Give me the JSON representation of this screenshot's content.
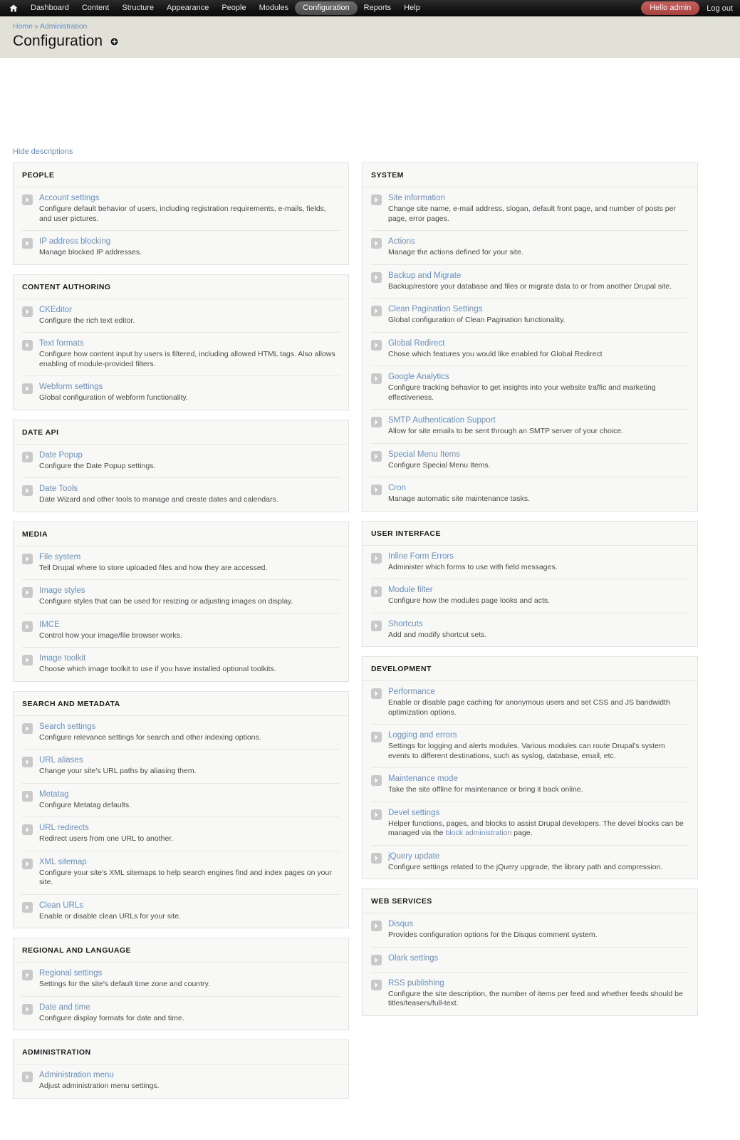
{
  "toolbar": {
    "home_icon": "home-icon",
    "items": [
      {
        "label": "Dashboard",
        "active": false
      },
      {
        "label": "Content",
        "active": false
      },
      {
        "label": "Structure",
        "active": false
      },
      {
        "label": "Appearance",
        "active": false
      },
      {
        "label": "People",
        "active": false
      },
      {
        "label": "Modules",
        "active": false
      },
      {
        "label": "Configuration",
        "active": true
      },
      {
        "label": "Reports",
        "active": false
      },
      {
        "label": "Help",
        "active": false
      }
    ],
    "greeting": "Hello admin",
    "logout": "Log out"
  },
  "breadcrumb": {
    "home": "Home",
    "separator": "»",
    "current": "Administration"
  },
  "page": {
    "title": "Configuration",
    "shortcut_icon": "add-shortcut-icon"
  },
  "actions": {
    "hide_descriptions": "Hide descriptions"
  },
  "colors": {
    "link": "#6a8fbd",
    "toolbar_bg": "#141414",
    "greeting_badge": "#b5524f",
    "panel_bg": "#f8f8f7",
    "header_bg": "#e2e1d7"
  },
  "left_column": [
    {
      "title": "PEOPLE",
      "items": [
        {
          "label": "Account settings",
          "desc": "Configure default behavior of users, including registration requirements, e-mails, fields, and user pictures."
        },
        {
          "label": "IP address blocking",
          "desc": "Manage blocked IP addresses."
        }
      ]
    },
    {
      "title": "CONTENT AUTHORING",
      "items": [
        {
          "label": "CKEditor",
          "desc": "Configure the rich text editor."
        },
        {
          "label": "Text formats",
          "desc": "Configure how content input by users is filtered, including allowed HTML tags. Also allows enabling of module-provided filters."
        },
        {
          "label": "Webform settings",
          "desc": "Global configuration of webform functionality."
        }
      ]
    },
    {
      "title": "DATE API",
      "items": [
        {
          "label": "Date Popup",
          "desc": "Configure the Date Popup settings."
        },
        {
          "label": "Date Tools",
          "desc": "Date Wizard and other tools to manage and create dates and calendars."
        }
      ]
    },
    {
      "title": "MEDIA",
      "items": [
        {
          "label": "File system",
          "desc": "Tell Drupal where to store uploaded files and how they are accessed."
        },
        {
          "label": "Image styles",
          "desc": "Configure styles that can be used for resizing or adjusting images on display."
        },
        {
          "label": "IMCE",
          "desc": "Control how your image/file browser works."
        },
        {
          "label": "Image toolkit",
          "desc": "Choose which image toolkit to use if you have installed optional toolkits."
        }
      ]
    },
    {
      "title": "SEARCH AND METADATA",
      "items": [
        {
          "label": "Search settings",
          "desc": "Configure relevance settings for search and other indexing options."
        },
        {
          "label": "URL aliases",
          "desc": "Change your site's URL paths by aliasing them."
        },
        {
          "label": "Metatag",
          "desc": "Configure Metatag defaults."
        },
        {
          "label": "URL redirects",
          "desc": "Redirect users from one URL to another."
        },
        {
          "label": "XML sitemap",
          "desc": "Configure your site's XML sitemaps to help search engines find and index pages on your site."
        },
        {
          "label": "Clean URLs",
          "desc": "Enable or disable clean URLs for your site."
        }
      ]
    },
    {
      "title": "REGIONAL AND LANGUAGE",
      "items": [
        {
          "label": "Regional settings",
          "desc": "Settings for the site's default time zone and country."
        },
        {
          "label": "Date and time",
          "desc": "Configure display formats for date and time."
        }
      ]
    },
    {
      "title": "ADMINISTRATION",
      "items": [
        {
          "label": "Administration menu",
          "desc": "Adjust administration menu settings."
        }
      ]
    }
  ],
  "right_column": [
    {
      "title": "SYSTEM",
      "items": [
        {
          "label": "Site information",
          "desc": "Change site name, e-mail address, slogan, default front page, and number of posts per page, error pages."
        },
        {
          "label": "Actions",
          "desc": "Manage the actions defined for your site."
        },
        {
          "label": "Backup and Migrate",
          "desc": "Backup/restore your database and files or migrate data to or from another Drupal site."
        },
        {
          "label": "Clean Pagination Settings",
          "desc": "Global configuration of Clean Pagination functionality."
        },
        {
          "label": "Global Redirect",
          "desc": "Chose which features you would like enabled for Global Redirect"
        },
        {
          "label": "Google Analytics",
          "desc": "Configure tracking behavior to get insights into your website traffic and marketing effectiveness."
        },
        {
          "label": "SMTP Authentication Support",
          "desc": "Allow for site emails to be sent through an SMTP server of your choice."
        },
        {
          "label": "Special Menu Items",
          "desc": "Configure Special Menu Items."
        },
        {
          "label": "Cron",
          "desc": "Manage automatic site maintenance tasks."
        }
      ]
    },
    {
      "title": "USER INTERFACE",
      "items": [
        {
          "label": "Inline Form Errors",
          "desc": "Administer which forms to use with field messages."
        },
        {
          "label": "Module filter",
          "desc": "Configure how the modules page looks and acts."
        },
        {
          "label": "Shortcuts",
          "desc": "Add and modify shortcut sets."
        }
      ]
    },
    {
      "title": "DEVELOPMENT",
      "items": [
        {
          "label": "Performance",
          "desc": "Enable or disable page caching for anonymous users and set CSS and JS bandwidth optimization options."
        },
        {
          "label": "Logging and errors",
          "desc": "Settings for logging and alerts modules. Various modules can route Drupal's system events to different destinations, such as syslog, database, email, etc."
        },
        {
          "label": "Maintenance mode",
          "desc": "Take the site offline for maintenance or bring it back online."
        },
        {
          "label": "Devel settings",
          "desc_parts": [
            {
              "text": "Helper functions, pages, and blocks to assist Drupal developers. The devel blocks can be managed via the "
            },
            {
              "text": "block administration",
              "link": true
            },
            {
              "text": " page."
            }
          ]
        },
        {
          "label": "jQuery update",
          "desc": "Configure settings related to the jQuery upgrade, the library path and compression."
        }
      ]
    },
    {
      "title": "WEB SERVICES",
      "items": [
        {
          "label": "Disqus",
          "desc": "Provides configuration options for the Disqus comment system."
        },
        {
          "label": "Olark settings",
          "desc": ""
        },
        {
          "label": "RSS publishing",
          "desc": "Configure the site description, the number of items per feed and whether feeds should be titles/teasers/full-text."
        }
      ]
    }
  ]
}
